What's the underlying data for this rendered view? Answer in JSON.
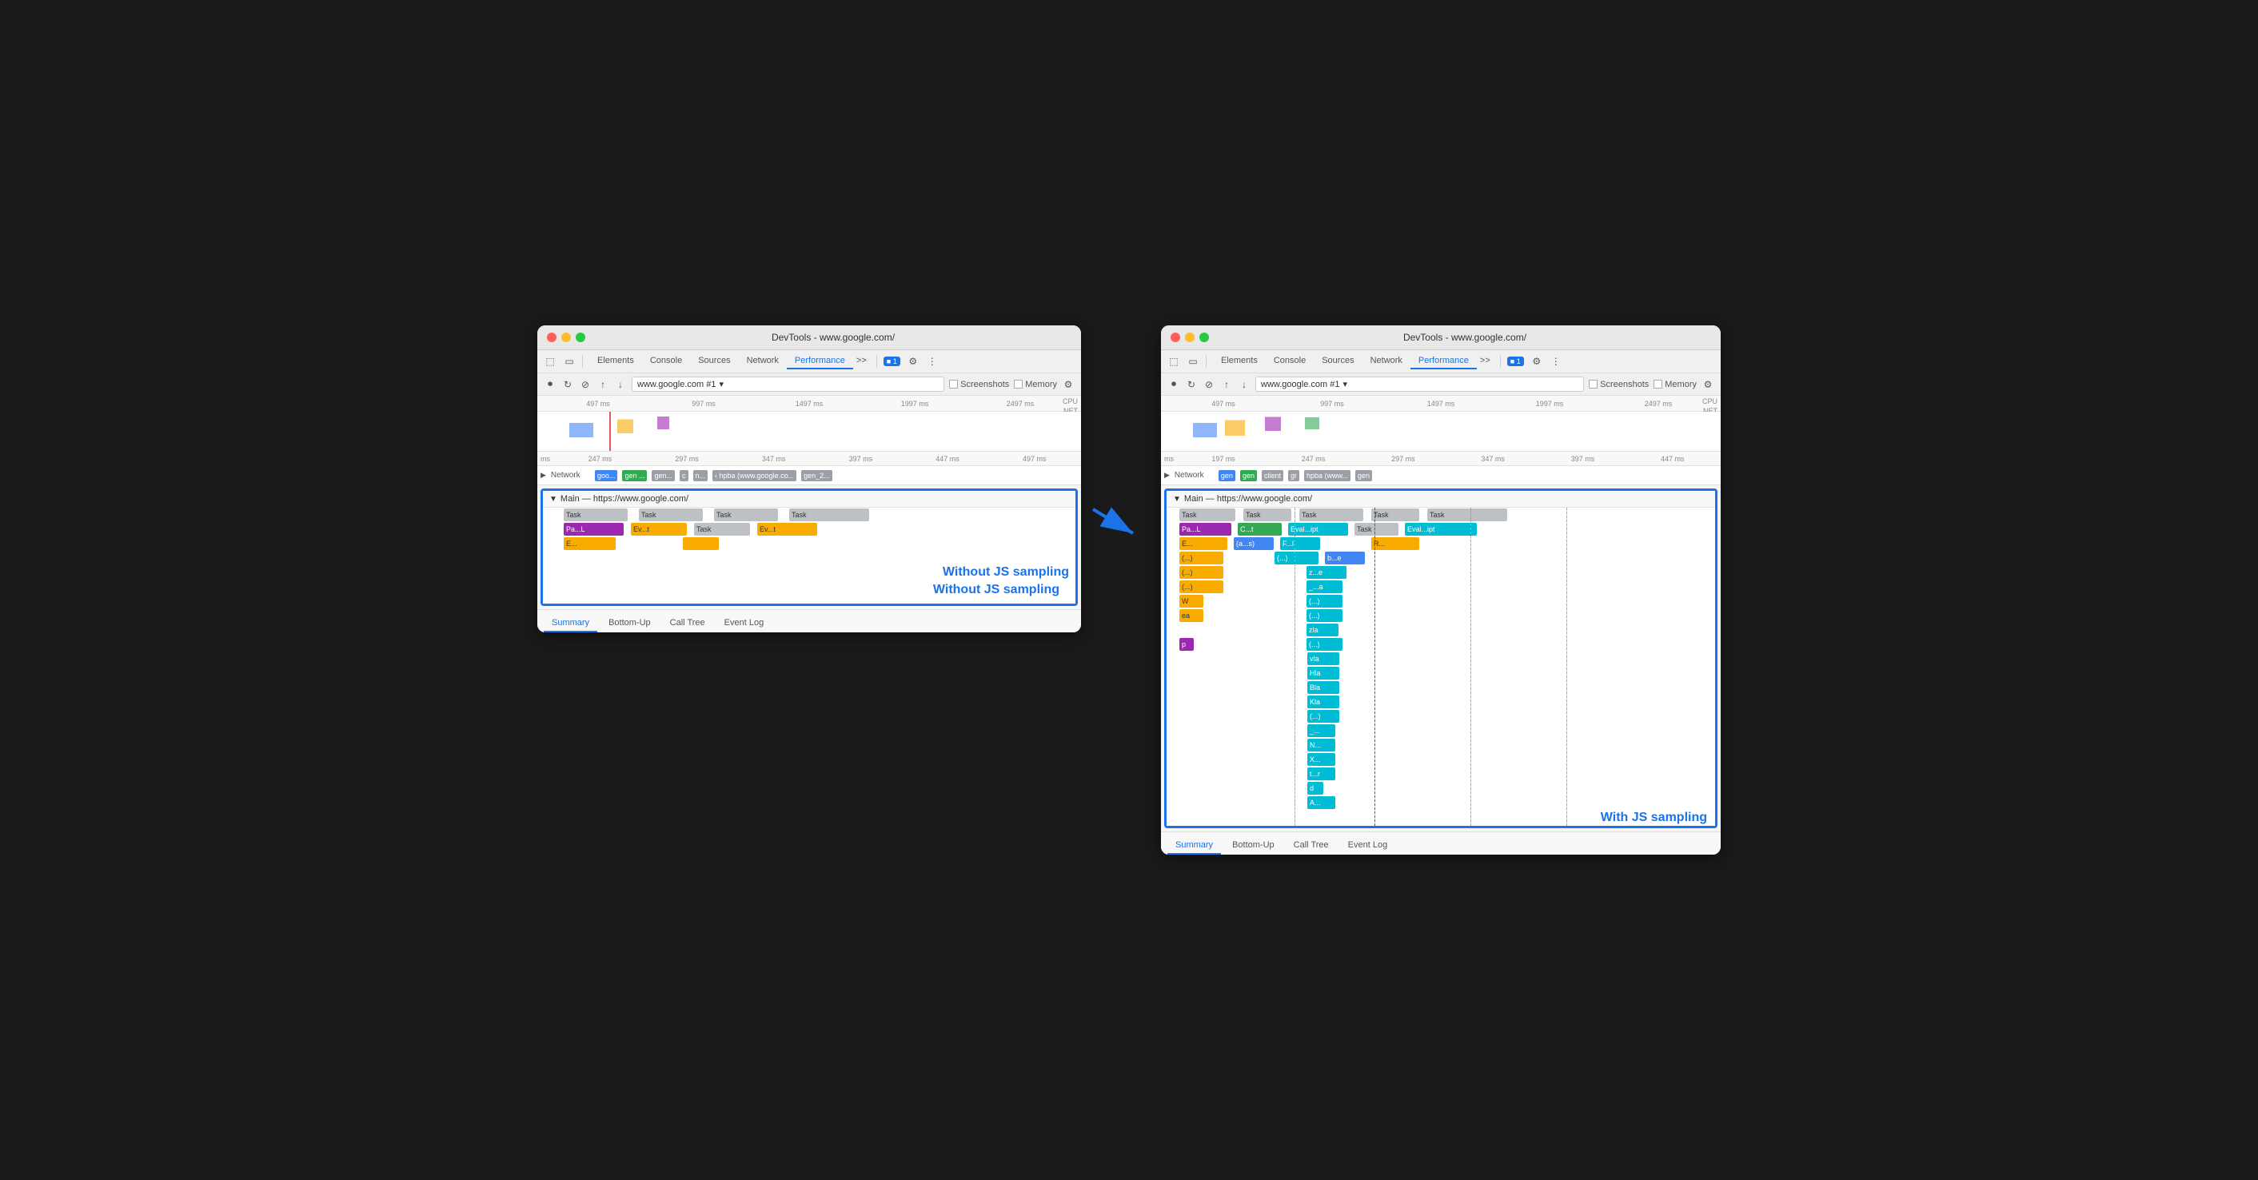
{
  "left_window": {
    "title": "DevTools - www.google.com/",
    "tabs": [
      "Elements",
      "Console",
      "Sources",
      "Network",
      "Performance"
    ],
    "active_tab": "Performance",
    "url": "www.google.com #1",
    "checkboxes": [
      "Screenshots",
      "Memory"
    ],
    "ruler_ticks": [
      "497 ms",
      "997 ms",
      "1497 ms",
      "1997 ms",
      "2497 ms"
    ],
    "second_ruler": [
      "ms",
      "247 ms",
      "297 ms",
      "347 ms",
      "397 ms",
      "447 ms",
      "497 ms"
    ],
    "cpu_label": "CPU",
    "net_label": "NET",
    "main_header": "Main — https://www.google.com/",
    "flame_rows": [
      {
        "blocks": [
          {
            "label": "Task",
            "color": "gray",
            "width": 80
          },
          {
            "label": "Task",
            "color": "gray",
            "width": 80
          },
          {
            "label": "Task",
            "color": "gray",
            "width": 80
          },
          {
            "label": "Task",
            "color": "gray",
            "width": 80
          }
        ]
      },
      {
        "blocks": [
          {
            "label": "Pa...L",
            "color": "purple",
            "width": 70
          },
          {
            "label": "Ev...t",
            "color": "yellow",
            "width": 70
          },
          {
            "label": "Task",
            "color": "gray",
            "width": 70
          },
          {
            "label": "Ev...t",
            "color": "yellow",
            "width": 70
          }
        ]
      },
      {
        "blocks": [
          {
            "label": "E...",
            "color": "yellow",
            "width": 70
          },
          {
            "label": "",
            "color": "yellow",
            "width": 40
          }
        ]
      }
    ],
    "annotation": "Without JS sampling",
    "bottom_tabs": [
      "Summary",
      "Bottom-Up",
      "Call Tree",
      "Event Log"
    ],
    "active_bottom_tab": "Summary"
  },
  "right_window": {
    "title": "DevTools - www.google.com/",
    "tabs": [
      "Elements",
      "Console",
      "Sources",
      "Network",
      "Performance"
    ],
    "active_tab": "Performance",
    "url": "www.google.com #1",
    "checkboxes": [
      "Screenshots",
      "Memory"
    ],
    "ruler_ticks": [
      "497 ms",
      "997 ms",
      "1497 ms",
      "1997 ms",
      "2497 ms"
    ],
    "second_ruler": [
      "ms",
      "197 ms",
      "247 ms",
      "297 ms",
      "347 ms",
      "397 ms",
      "447 ms"
    ],
    "cpu_label": "CPU",
    "net_label": "NET",
    "main_header": "Main — https://www.google.com/",
    "top_flame_rows": [
      [
        "Task",
        "Task",
        "Task",
        "Task",
        "Task"
      ],
      [
        "Pa...L",
        "C...t",
        "Eval...ipt",
        "Task",
        "Eval...ipt"
      ],
      [
        "E...",
        "(a...s)",
        "F...l",
        "R..."
      ],
      [
        "(...)",
        "(...)",
        "b...e"
      ],
      [
        "(...)",
        "z...e"
      ],
      [
        "(...)",
        "_...a"
      ],
      [
        "W",
        "(...)"
      ],
      [
        "ea",
        "(...)"
      ],
      [
        "",
        "zla"
      ],
      [
        "p",
        "(...)"
      ],
      [
        "",
        "vla"
      ],
      [
        "",
        "Hla"
      ],
      [
        "",
        "Bla"
      ],
      [
        "",
        "Kla"
      ],
      [
        "",
        "(...)"
      ],
      [
        "",
        "_..."
      ],
      [
        "",
        "N..."
      ],
      [
        "",
        "X..."
      ],
      [
        "",
        "t...r"
      ],
      [
        "",
        "d"
      ],
      [
        "",
        "A..."
      ]
    ],
    "annotation": "With JS sampling",
    "bottom_tabs": [
      "Summary",
      "Bottom-Up",
      "Call Tree",
      "Event Log"
    ],
    "active_bottom_tab": "Summary"
  },
  "colors": {
    "accent": "#1a73e8",
    "task_gray": "#bdc1c6",
    "eval_purple": "#9c27b0",
    "parse_purple": "#9c27b0",
    "compile_green": "#34a853",
    "event_yellow": "#f9ab00",
    "teal": "#00bcd4",
    "blue_chip": "#4285f4"
  }
}
